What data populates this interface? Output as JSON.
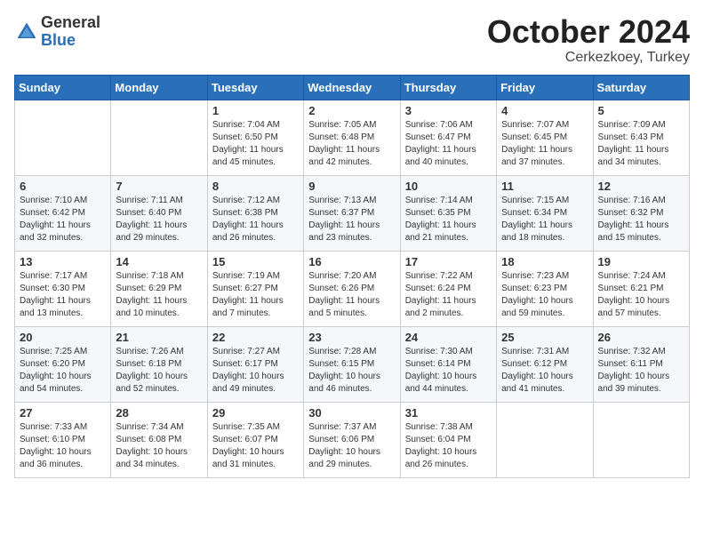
{
  "header": {
    "logo": {
      "general": "General",
      "blue": "Blue"
    },
    "month": "October 2024",
    "location": "Cerkezkoey, Turkey"
  },
  "weekdays": [
    "Sunday",
    "Monday",
    "Tuesday",
    "Wednesday",
    "Thursday",
    "Friday",
    "Saturday"
  ],
  "weeks": [
    [
      {
        "day": "",
        "sunrise": "",
        "sunset": "",
        "daylight": ""
      },
      {
        "day": "",
        "sunrise": "",
        "sunset": "",
        "daylight": ""
      },
      {
        "day": "1",
        "sunrise": "Sunrise: 7:04 AM",
        "sunset": "Sunset: 6:50 PM",
        "daylight": "Daylight: 11 hours and 45 minutes."
      },
      {
        "day": "2",
        "sunrise": "Sunrise: 7:05 AM",
        "sunset": "Sunset: 6:48 PM",
        "daylight": "Daylight: 11 hours and 42 minutes."
      },
      {
        "day": "3",
        "sunrise": "Sunrise: 7:06 AM",
        "sunset": "Sunset: 6:47 PM",
        "daylight": "Daylight: 11 hours and 40 minutes."
      },
      {
        "day": "4",
        "sunrise": "Sunrise: 7:07 AM",
        "sunset": "Sunset: 6:45 PM",
        "daylight": "Daylight: 11 hours and 37 minutes."
      },
      {
        "day": "5",
        "sunrise": "Sunrise: 7:09 AM",
        "sunset": "Sunset: 6:43 PM",
        "daylight": "Daylight: 11 hours and 34 minutes."
      }
    ],
    [
      {
        "day": "6",
        "sunrise": "Sunrise: 7:10 AM",
        "sunset": "Sunset: 6:42 PM",
        "daylight": "Daylight: 11 hours and 32 minutes."
      },
      {
        "day": "7",
        "sunrise": "Sunrise: 7:11 AM",
        "sunset": "Sunset: 6:40 PM",
        "daylight": "Daylight: 11 hours and 29 minutes."
      },
      {
        "day": "8",
        "sunrise": "Sunrise: 7:12 AM",
        "sunset": "Sunset: 6:38 PM",
        "daylight": "Daylight: 11 hours and 26 minutes."
      },
      {
        "day": "9",
        "sunrise": "Sunrise: 7:13 AM",
        "sunset": "Sunset: 6:37 PM",
        "daylight": "Daylight: 11 hours and 23 minutes."
      },
      {
        "day": "10",
        "sunrise": "Sunrise: 7:14 AM",
        "sunset": "Sunset: 6:35 PM",
        "daylight": "Daylight: 11 hours and 21 minutes."
      },
      {
        "day": "11",
        "sunrise": "Sunrise: 7:15 AM",
        "sunset": "Sunset: 6:34 PM",
        "daylight": "Daylight: 11 hours and 18 minutes."
      },
      {
        "day": "12",
        "sunrise": "Sunrise: 7:16 AM",
        "sunset": "Sunset: 6:32 PM",
        "daylight": "Daylight: 11 hours and 15 minutes."
      }
    ],
    [
      {
        "day": "13",
        "sunrise": "Sunrise: 7:17 AM",
        "sunset": "Sunset: 6:30 PM",
        "daylight": "Daylight: 11 hours and 13 minutes."
      },
      {
        "day": "14",
        "sunrise": "Sunrise: 7:18 AM",
        "sunset": "Sunset: 6:29 PM",
        "daylight": "Daylight: 11 hours and 10 minutes."
      },
      {
        "day": "15",
        "sunrise": "Sunrise: 7:19 AM",
        "sunset": "Sunset: 6:27 PM",
        "daylight": "Daylight: 11 hours and 7 minutes."
      },
      {
        "day": "16",
        "sunrise": "Sunrise: 7:20 AM",
        "sunset": "Sunset: 6:26 PM",
        "daylight": "Daylight: 11 hours and 5 minutes."
      },
      {
        "day": "17",
        "sunrise": "Sunrise: 7:22 AM",
        "sunset": "Sunset: 6:24 PM",
        "daylight": "Daylight: 11 hours and 2 minutes."
      },
      {
        "day": "18",
        "sunrise": "Sunrise: 7:23 AM",
        "sunset": "Sunset: 6:23 PM",
        "daylight": "Daylight: 10 hours and 59 minutes."
      },
      {
        "day": "19",
        "sunrise": "Sunrise: 7:24 AM",
        "sunset": "Sunset: 6:21 PM",
        "daylight": "Daylight: 10 hours and 57 minutes."
      }
    ],
    [
      {
        "day": "20",
        "sunrise": "Sunrise: 7:25 AM",
        "sunset": "Sunset: 6:20 PM",
        "daylight": "Daylight: 10 hours and 54 minutes."
      },
      {
        "day": "21",
        "sunrise": "Sunrise: 7:26 AM",
        "sunset": "Sunset: 6:18 PM",
        "daylight": "Daylight: 10 hours and 52 minutes."
      },
      {
        "day": "22",
        "sunrise": "Sunrise: 7:27 AM",
        "sunset": "Sunset: 6:17 PM",
        "daylight": "Daylight: 10 hours and 49 minutes."
      },
      {
        "day": "23",
        "sunrise": "Sunrise: 7:28 AM",
        "sunset": "Sunset: 6:15 PM",
        "daylight": "Daylight: 10 hours and 46 minutes."
      },
      {
        "day": "24",
        "sunrise": "Sunrise: 7:30 AM",
        "sunset": "Sunset: 6:14 PM",
        "daylight": "Daylight: 10 hours and 44 minutes."
      },
      {
        "day": "25",
        "sunrise": "Sunrise: 7:31 AM",
        "sunset": "Sunset: 6:12 PM",
        "daylight": "Daylight: 10 hours and 41 minutes."
      },
      {
        "day": "26",
        "sunrise": "Sunrise: 7:32 AM",
        "sunset": "Sunset: 6:11 PM",
        "daylight": "Daylight: 10 hours and 39 minutes."
      }
    ],
    [
      {
        "day": "27",
        "sunrise": "Sunrise: 7:33 AM",
        "sunset": "Sunset: 6:10 PM",
        "daylight": "Daylight: 10 hours and 36 minutes."
      },
      {
        "day": "28",
        "sunrise": "Sunrise: 7:34 AM",
        "sunset": "Sunset: 6:08 PM",
        "daylight": "Daylight: 10 hours and 34 minutes."
      },
      {
        "day": "29",
        "sunrise": "Sunrise: 7:35 AM",
        "sunset": "Sunset: 6:07 PM",
        "daylight": "Daylight: 10 hours and 31 minutes."
      },
      {
        "day": "30",
        "sunrise": "Sunrise: 7:37 AM",
        "sunset": "Sunset: 6:06 PM",
        "daylight": "Daylight: 10 hours and 29 minutes."
      },
      {
        "day": "31",
        "sunrise": "Sunrise: 7:38 AM",
        "sunset": "Sunset: 6:04 PM",
        "daylight": "Daylight: 10 hours and 26 minutes."
      },
      {
        "day": "",
        "sunrise": "",
        "sunset": "",
        "daylight": ""
      },
      {
        "day": "",
        "sunrise": "",
        "sunset": "",
        "daylight": ""
      }
    ]
  ]
}
